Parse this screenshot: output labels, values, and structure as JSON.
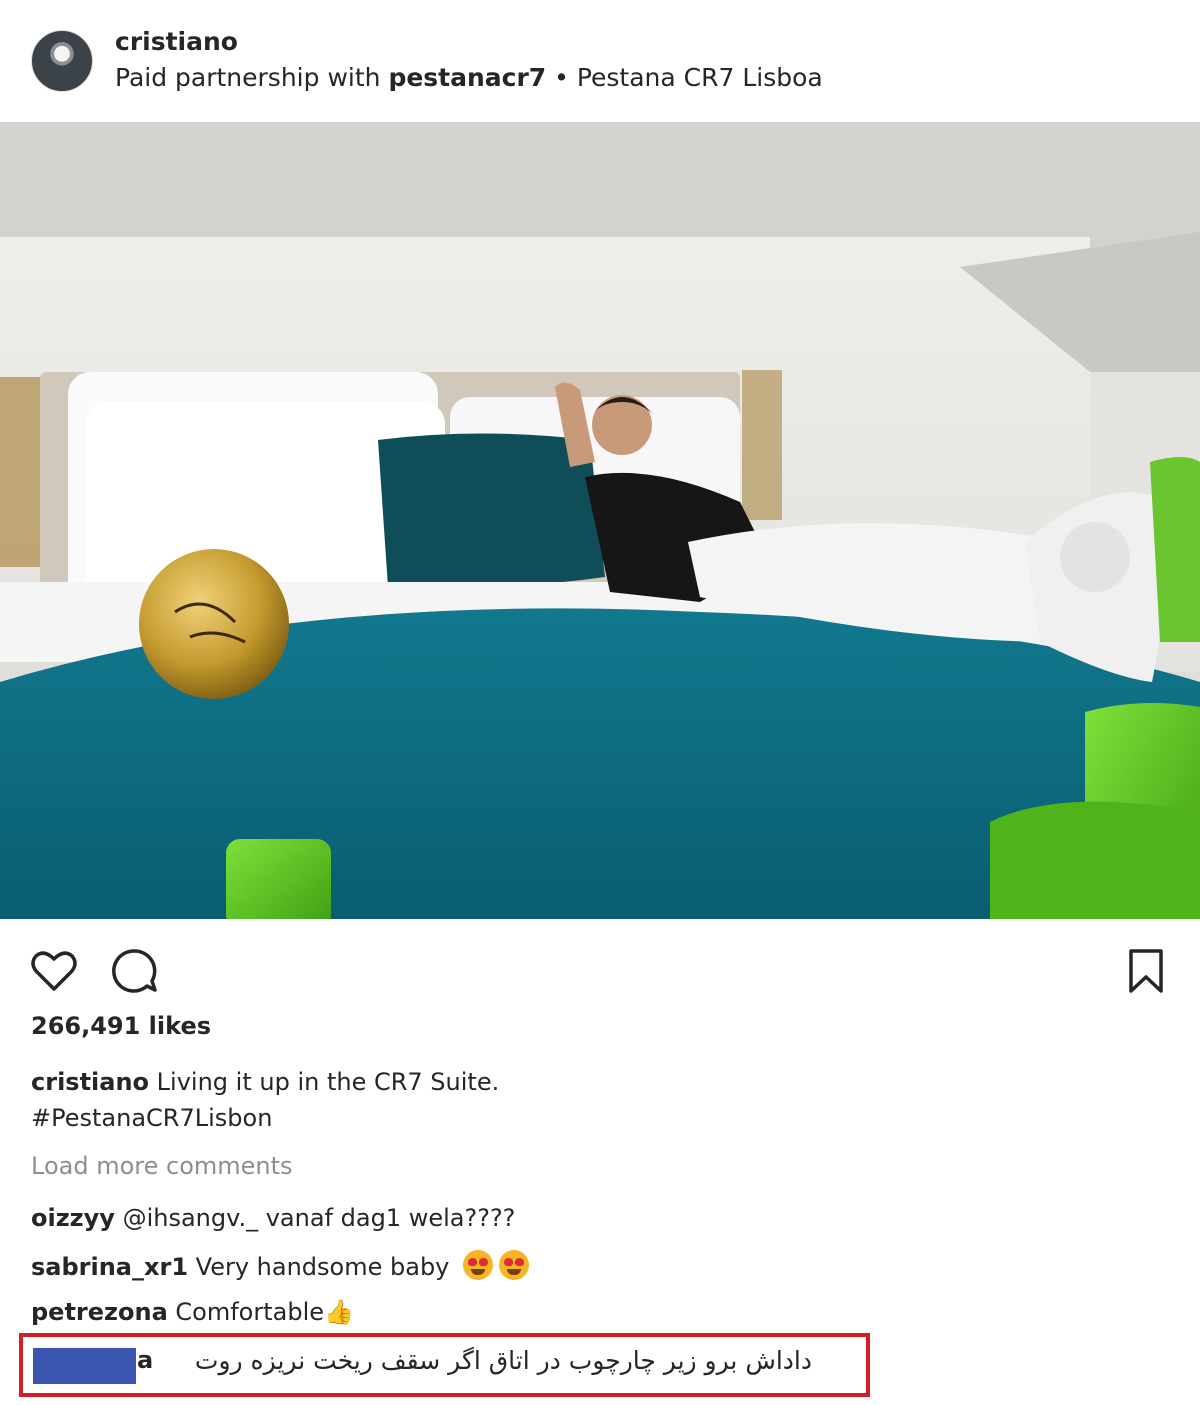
{
  "post": {
    "username": "cristiano",
    "paid_partnership_prefix": "Paid partnership with ",
    "partner": "pestanacr7",
    "location_separator": " • ",
    "location": "Pestana CR7 Lisboa"
  },
  "icons": {
    "like": "heart-icon",
    "comment": "comment-icon",
    "save": "bookmark-icon"
  },
  "stats": {
    "likes": "266,491 likes"
  },
  "caption": {
    "username": "cristiano",
    "text": " Living it up in the CR7 Suite.",
    "hashtag": "#PestanaCR7Lisbon"
  },
  "load_more": "Load more comments",
  "comments": [
    {
      "username": "oizzyy",
      "text": " @ihsangv._ vanaf dag1 wela????"
    },
    {
      "username": "sabrina_xr1",
      "text": " Very handsome baby"
    },
    {
      "username": "petrezona",
      "text": " Comfortable"
    },
    {
      "username_visible_tail": "a",
      "text": "داداش برو زیر چارچوب در اتاق اگر سقف ریخت نریزه روت"
    }
  ],
  "colors": {
    "highlight_border": "#d01f27",
    "redaction": "#3a56b0",
    "bedspread": "#0e6f84",
    "chair_green": "#5cc51f"
  }
}
